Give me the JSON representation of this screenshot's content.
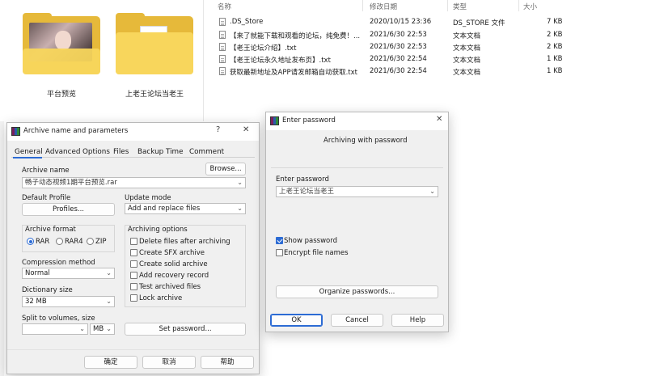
{
  "explorer": {
    "folders": [
      {
        "label": "平台预览"
      },
      {
        "label": "上老王论坛当老王"
      }
    ],
    "columns": {
      "name": "名称",
      "modified": "修改日期",
      "type": "类型",
      "size": "大小"
    },
    "files": [
      {
        "name": ".DS_Store",
        "modified": "2020/10/15 23:36",
        "type": "DS_STORE 文件",
        "size": "7 KB"
      },
      {
        "name": "【来了就能下载和观看的论坛，纯免费！...",
        "modified": "2021/6/30 22:53",
        "type": "文本文档",
        "size": "2 KB"
      },
      {
        "name": "【老王论坛介绍】.txt",
        "modified": "2021/6/30 22:53",
        "type": "文本文档",
        "size": "2 KB"
      },
      {
        "name": "【老王论坛永久地址发布页】.txt",
        "modified": "2021/6/30 22:54",
        "type": "文本文档",
        "size": "1 KB"
      },
      {
        "name": "获取最新地址及APP请发邮箱自动获取.txt",
        "modified": "2021/6/30 22:54",
        "type": "文本文档",
        "size": "1 KB"
      }
    ]
  },
  "archive_dialog": {
    "title": "Archive name and parameters",
    "help": "?",
    "close": "✕",
    "tabs": [
      "General",
      "Advanced",
      "Options",
      "Files",
      "Backup",
      "Time",
      "Comment"
    ],
    "archive_name_label": "Archive name",
    "browse_label": "Browse...",
    "archive_name_value": "畅子动态视频1期平台预览.rar",
    "default_profile_label": "Default Profile",
    "profiles_label": "Profiles...",
    "update_mode_label": "Update mode",
    "update_mode_value": "Add and replace files",
    "archive_format_label": "Archive format",
    "formats": [
      "RAR",
      "RAR4",
      "ZIP"
    ],
    "archiving_options_label": "Archiving options",
    "options": [
      "Delete files after archiving",
      "Create SFX archive",
      "Create solid archive",
      "Add recovery record",
      "Test archived files",
      "Lock archive"
    ],
    "compression_method_label": "Compression method",
    "compression_method_value": "Normal",
    "dictionary_size_label": "Dictionary size",
    "dictionary_size_value": "32 MB",
    "split_label": "Split to volumes, size",
    "split_unit": "MB",
    "set_password_label": "Set password...",
    "ok_label": "确定",
    "cancel_label": "取消",
    "help_label": "帮助"
  },
  "password_dialog": {
    "title": "Enter password",
    "close": "✕",
    "heading": "Archiving with password",
    "enter_password_label": "Enter password",
    "password_value": "上老王论坛当老王",
    "show_password_label": "Show password",
    "encrypt_names_label": "Encrypt file names",
    "organize_label": "Organize passwords...",
    "ok_label": "OK",
    "cancel_label": "Cancel",
    "help_label": "Help"
  }
}
